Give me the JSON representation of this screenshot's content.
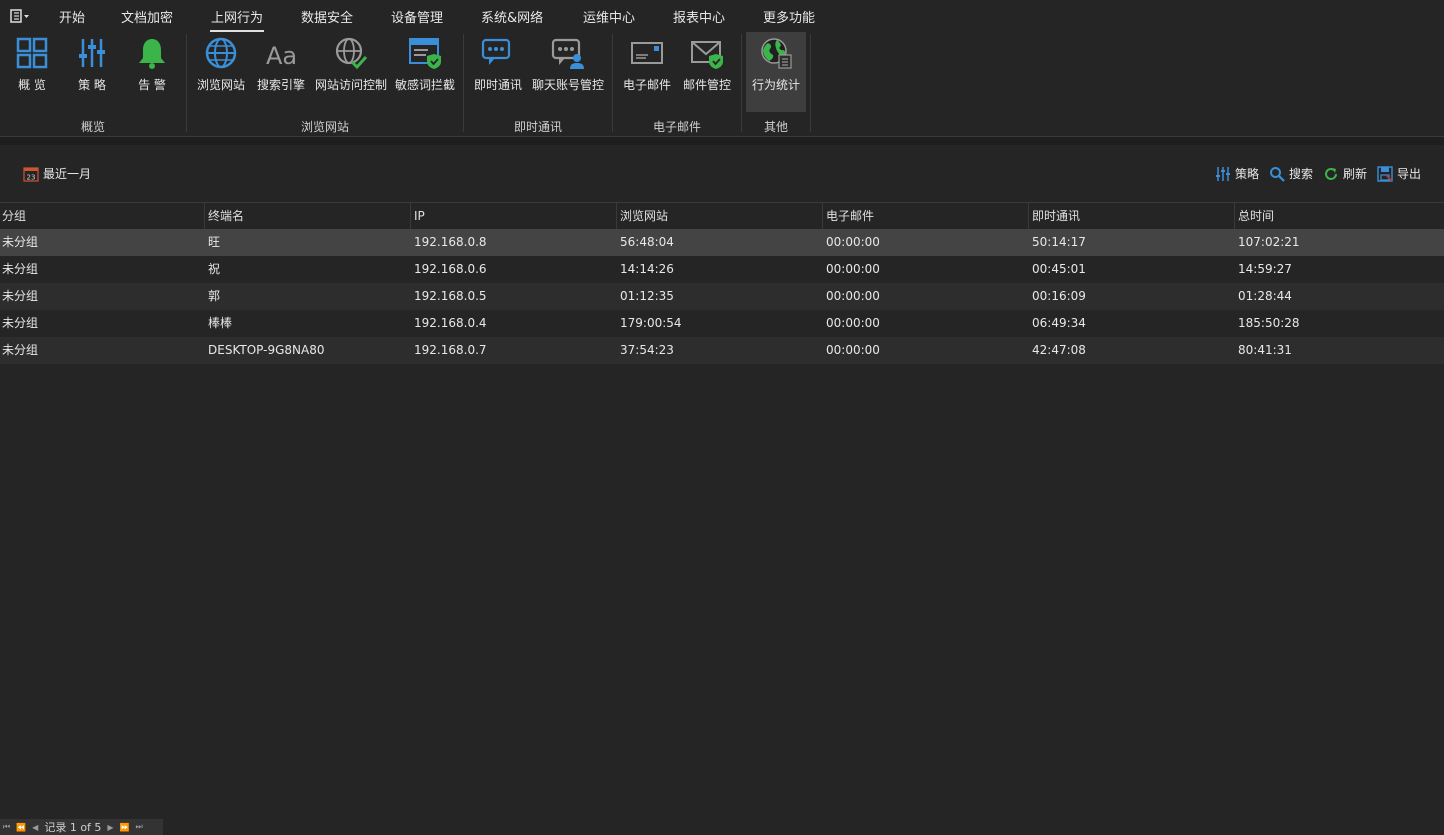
{
  "menu": {
    "tabs": [
      "开始",
      "文档加密",
      "上网行为",
      "数据安全",
      "设备管理",
      "系统&网络",
      "运维中心",
      "报表中心",
      "更多功能"
    ],
    "active": "上网行为"
  },
  "ribbon": {
    "buttons": [
      {
        "label": "概 览",
        "icon": "overview-grid-icon"
      },
      {
        "label": "策 略",
        "icon": "strategy-sliders-icon"
      },
      {
        "label": "告 警",
        "icon": "alarm-bell-icon"
      },
      {
        "label": "浏览网站",
        "icon": "globe-icon"
      },
      {
        "label": "搜索引擎",
        "icon": "font-aa-icon"
      },
      {
        "label": "网站访问控制",
        "icon": "globe-check-icon"
      },
      {
        "label": "敏感词拦截",
        "icon": "browser-shield-icon"
      },
      {
        "label": "即时通讯",
        "icon": "chat-bubble-icon"
      },
      {
        "label": "聊天账号管控",
        "icon": "chat-user-icon"
      },
      {
        "label": "电子邮件",
        "icon": "envelope-icon"
      },
      {
        "label": "邮件管控",
        "icon": "envelope-shield-icon"
      },
      {
        "label": "行为统计",
        "icon": "globe-stats-icon"
      }
    ],
    "groups": [
      "概览",
      "浏览网站",
      "即时通讯",
      "电子邮件",
      "其他"
    ]
  },
  "toolbar": {
    "date_range": "最近一月",
    "calendar_day": "23",
    "strategy": "策略",
    "search": "搜索",
    "refresh": "刷新",
    "export": "导出"
  },
  "table": {
    "columns": [
      "分组",
      "终端名",
      "IP",
      "浏览网站",
      "电子邮件",
      "即时通讯",
      "总时间"
    ],
    "rows": [
      [
        "未分组",
        "旺",
        "192.168.0.8",
        "56:48:04",
        "00:00:00",
        "50:14:17",
        "107:02:21"
      ],
      [
        "未分组",
        "祝",
        "192.168.0.6",
        "14:14:26",
        "00:00:00",
        "00:45:01",
        "14:59:27"
      ],
      [
        "未分组",
        "郭",
        "192.168.0.5",
        "01:12:35",
        "00:00:00",
        "00:16:09",
        "01:28:44"
      ],
      [
        "未分组",
        "棒棒",
        "192.168.0.4",
        "179:00:54",
        "00:00:00",
        "06:49:34",
        "185:50:28"
      ],
      [
        "未分组",
        "DESKTOP-9G8NA80",
        "192.168.0.7",
        "37:54:23",
        "00:00:00",
        "42:47:08",
        "80:41:31"
      ]
    ]
  },
  "footer": {
    "record_text": "记录 1 of 5"
  },
  "colors": {
    "accent_blue": "#3a8fd8",
    "accent_green": "#3bb54a",
    "background": "#252525",
    "selected_row": "#444444"
  }
}
